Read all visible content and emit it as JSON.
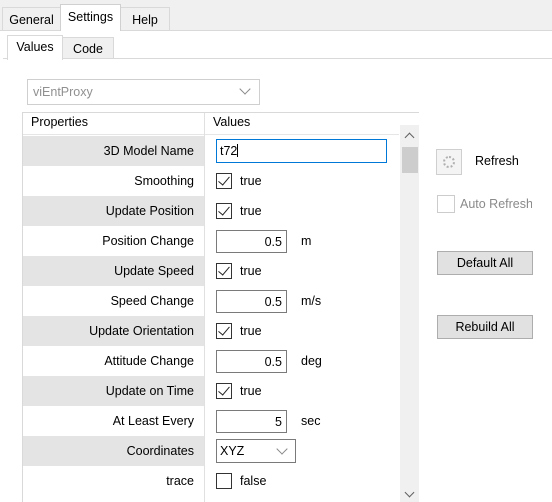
{
  "tabs_top": [
    "General",
    "Settings",
    "Help"
  ],
  "tabs_sub": [
    "Values",
    "Code"
  ],
  "proxy_select": {
    "value": "viEntProxy"
  },
  "grid": {
    "headers": {
      "properties": "Properties",
      "values": "Values"
    },
    "rows": [
      {
        "name": "3D Model Name",
        "type": "text",
        "value": "t72"
      },
      {
        "name": "Smoothing",
        "type": "check",
        "checked": true,
        "value": "true"
      },
      {
        "name": "Update Position",
        "type": "check",
        "checked": true,
        "value": "true"
      },
      {
        "name": "Position Change",
        "type": "number",
        "value": "0.5",
        "unit": "m"
      },
      {
        "name": "Update Speed",
        "type": "check",
        "checked": true,
        "value": "true"
      },
      {
        "name": "Speed Change",
        "type": "number",
        "value": "0.5",
        "unit": "m/s"
      },
      {
        "name": "Update Orientation",
        "type": "check",
        "checked": true,
        "value": "true"
      },
      {
        "name": "Attitude Change",
        "type": "number",
        "value": "0.5",
        "unit": "deg"
      },
      {
        "name": "Update on Time",
        "type": "check",
        "checked": true,
        "value": "true"
      },
      {
        "name": "At Least Every",
        "type": "number",
        "value": "5",
        "unit": "sec"
      },
      {
        "name": "Coordinates",
        "type": "select",
        "value": "XYZ"
      },
      {
        "name": "trace",
        "type": "check",
        "checked": false,
        "value": "false"
      }
    ]
  },
  "side": {
    "refresh_label": "Refresh",
    "auto_refresh_label": "Auto Refresh",
    "default_all_label": "Default All",
    "rebuild_all_label": "Rebuild All"
  }
}
